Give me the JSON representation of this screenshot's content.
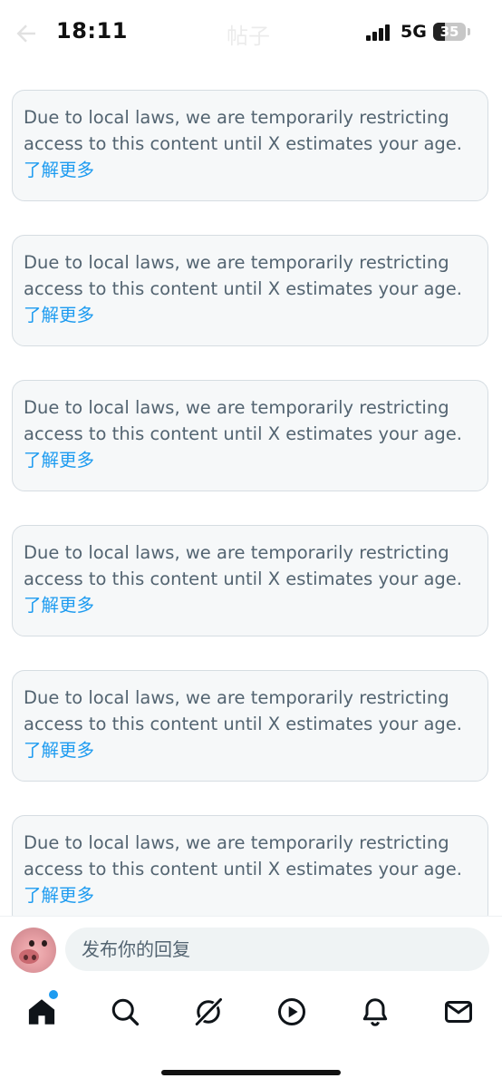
{
  "status_bar": {
    "time": "18:11",
    "network": "5G",
    "battery": "35",
    "battery_fraction": 0.35
  },
  "header": {
    "title": "帖子",
    "back_icon": "arrow-left-icon"
  },
  "notices": [
    {
      "message": "Due to local laws, we are temporarily restricting access to this content until X estimates your age.",
      "link": "了解更多"
    },
    {
      "message": "Due to local laws, we are temporarily restricting access to this content until X estimates your age.",
      "link": "了解更多"
    },
    {
      "message": "Due to local laws, we are temporarily restricting access to this content until X estimates your age.",
      "link": "了解更多"
    },
    {
      "message": "Due to local laws, we are temporarily restricting access to this content until X estimates your age.",
      "link": "了解更多"
    },
    {
      "message": "Due to local laws, we are temporarily restricting access to this content until X estimates your age.",
      "link": "了解更多"
    },
    {
      "message": "Due to local laws, we are temporarily restricting access to this content until X estimates your age.",
      "link": "了解更多"
    }
  ],
  "reply": {
    "placeholder": "发布你的回复"
  },
  "tabs": [
    {
      "icon": "home-icon",
      "active": true,
      "has_dot": true
    },
    {
      "icon": "search-icon",
      "active": false
    },
    {
      "icon": "grok-icon",
      "active": false
    },
    {
      "icon": "play-icon",
      "active": false
    },
    {
      "icon": "bell-icon",
      "active": false
    },
    {
      "icon": "mail-icon",
      "active": false
    }
  ],
  "colors": {
    "accent": "#1d9bf0",
    "secondary_text": "#536471",
    "card_background": "#f6f8f9",
    "card_border": "#d6dde2"
  }
}
